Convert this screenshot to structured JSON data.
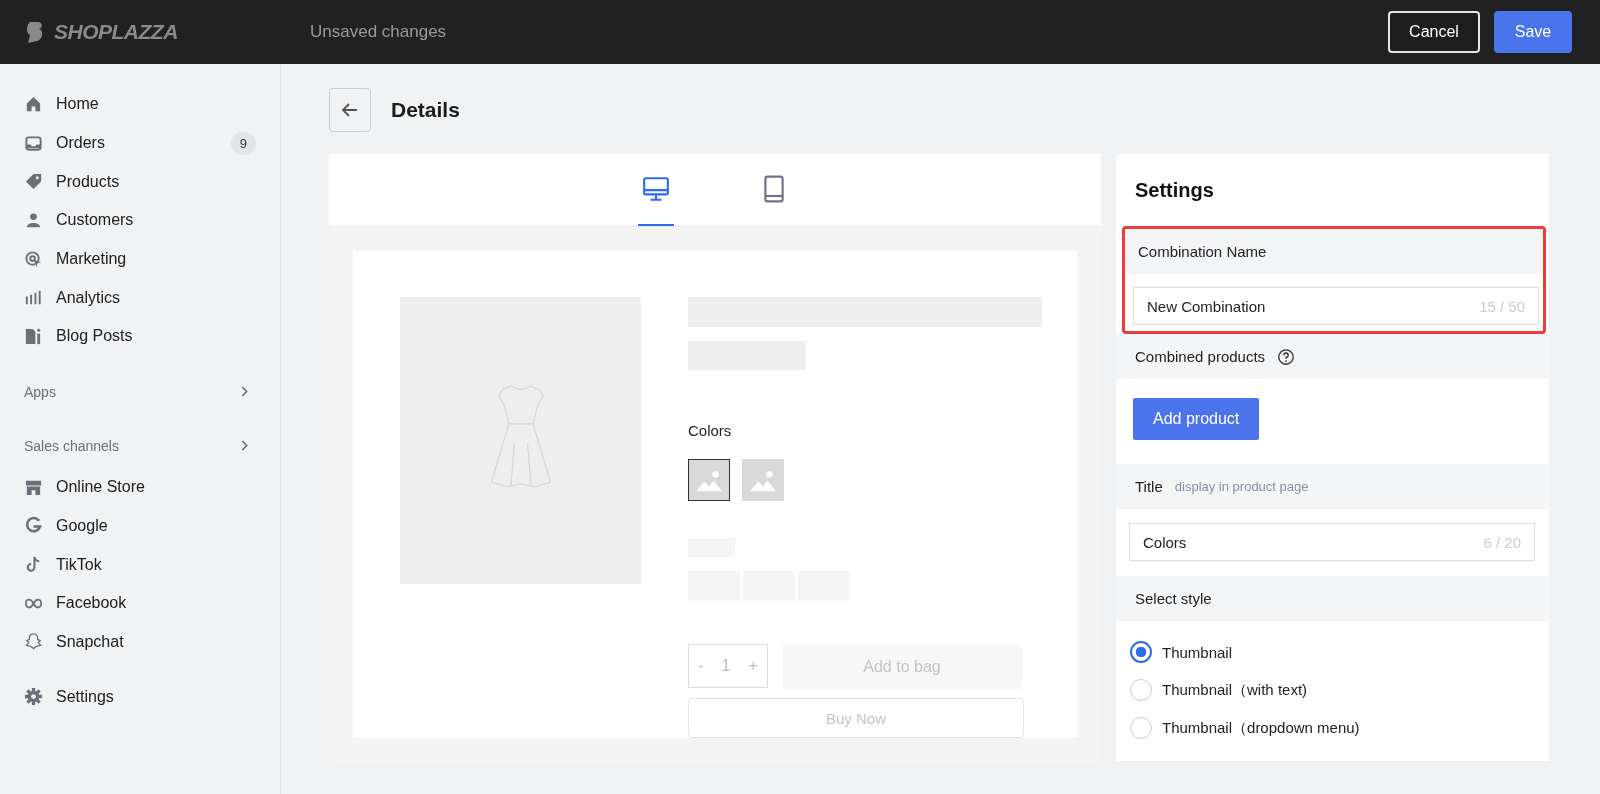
{
  "header": {
    "logo": "SHOPLAZZA",
    "status": "Unsaved changes",
    "buttons": [
      {
        "label": "Cancel",
        "kind": "secondary"
      },
      {
        "label": "Save",
        "kind": "primary"
      }
    ]
  },
  "sidebar": {
    "items": [
      {
        "label": "Home",
        "kind": "home"
      },
      {
        "label": "Orders",
        "kind": "inbox",
        "badge": "9"
      },
      {
        "label": "Products",
        "kind": "tag"
      },
      {
        "label": "Customers",
        "kind": "person"
      },
      {
        "label": "Marketing",
        "kind": "target"
      },
      {
        "label": "Analytics",
        "kind": "bars"
      },
      {
        "label": "Blog Posts",
        "kind": "blog"
      }
    ],
    "sections": [
      {
        "label": "Apps"
      },
      {
        "label": "Sales channels",
        "items": [
          {
            "label": "Online Store",
            "kind": "store"
          },
          {
            "label": "Google",
            "kind": "google"
          },
          {
            "label": "TikTok",
            "kind": "note"
          },
          {
            "label": "Facebook",
            "kind": "infinity"
          },
          {
            "label": "Snapchat",
            "kind": "ghost"
          }
        ]
      }
    ],
    "footer": {
      "label": "Settings",
      "kind": "gear"
    }
  },
  "page": {
    "title": "Details"
  },
  "preview": {
    "devices": [
      {
        "kind": "desktop",
        "selected": true
      },
      {
        "kind": "tablet",
        "selected": false
      }
    ],
    "colors_label": "Colors",
    "swatches": [
      {
        "selected": true
      },
      {
        "selected": false
      }
    ],
    "quantity": {
      "minus": "-",
      "value": "1",
      "plus": "+"
    },
    "add_to_bag": "Add to bag",
    "buy_now": "Buy Now"
  },
  "settings": {
    "title": "Settings",
    "combination_name": {
      "label": "Combination Name",
      "value": "New Combination",
      "counter": "15 / 50",
      "highlighted": true
    },
    "combined_products": {
      "label": "Combined products",
      "button": "Add product"
    },
    "title_field": {
      "label": "Title",
      "hint": "display in product page",
      "value": "Colors",
      "counter": "6 / 20"
    },
    "select_style": {
      "label": "Select style",
      "options": [
        {
          "label": "Thumbnail",
          "selected": true
        },
        {
          "label": "Thumbnail（with text)",
          "selected": false
        },
        {
          "label": "Thumbnail（dropdown menu)",
          "selected": false
        }
      ]
    }
  }
}
